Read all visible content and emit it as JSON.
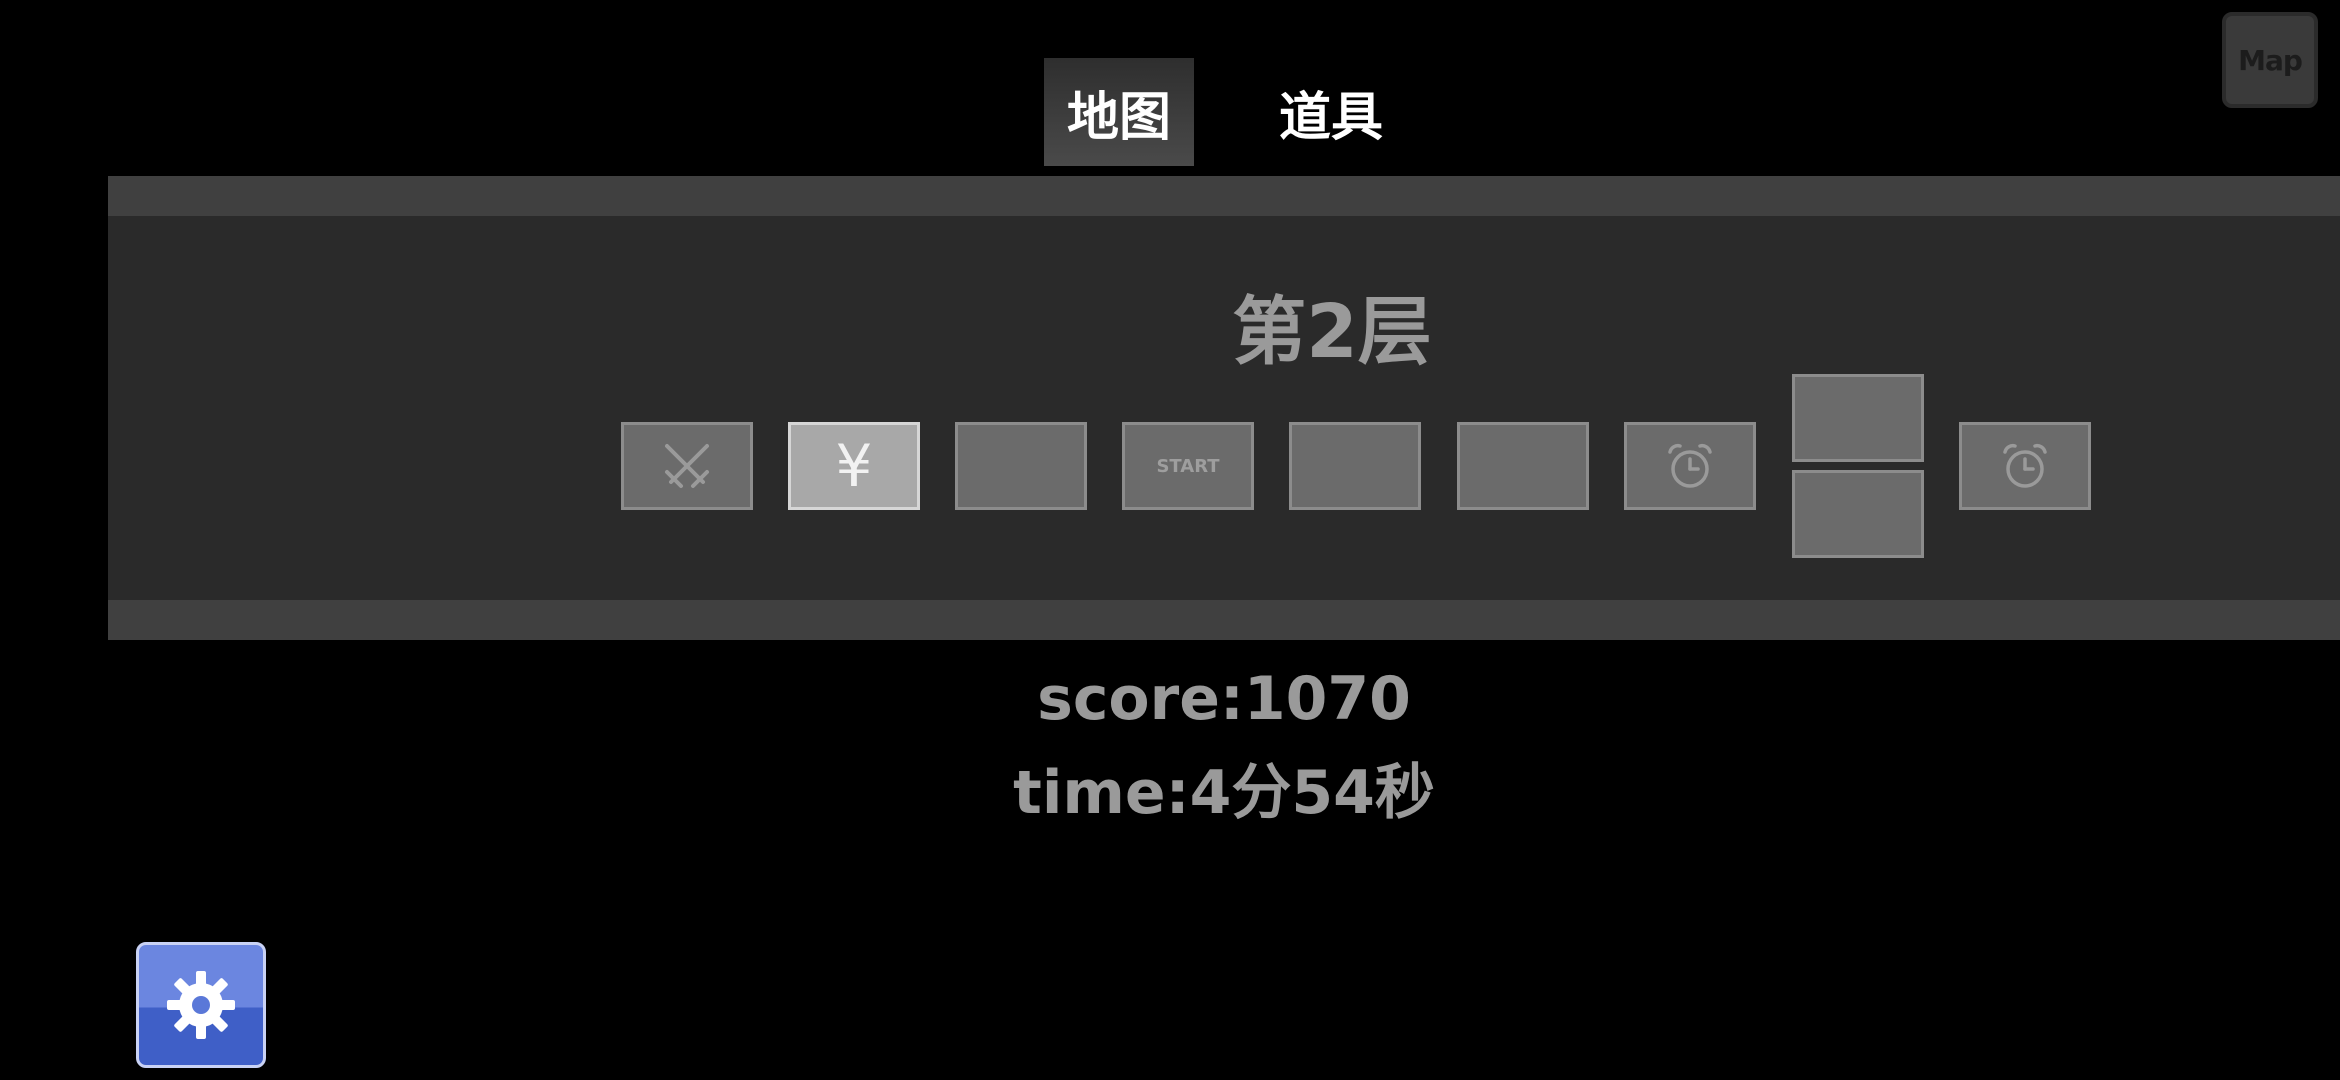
{
  "tabs": {
    "map_label": "地图",
    "items_label": "道具"
  },
  "map_button": {
    "label": "Map",
    "icon": "map-icon"
  },
  "floor": {
    "title": "第2层"
  },
  "rooms": [
    {
      "type": "battle",
      "icon": "crossed-swords-icon"
    },
    {
      "type": "shop",
      "label": "¥",
      "current": true
    },
    {
      "type": "empty"
    },
    {
      "type": "start",
      "label": "START"
    },
    {
      "type": "empty"
    },
    {
      "type": "empty"
    },
    {
      "type": "timed",
      "icon": "alarm-clock-icon"
    },
    {
      "type": "empty"
    },
    {
      "type": "empty"
    },
    {
      "type": "timed",
      "icon": "alarm-clock-icon"
    }
  ],
  "stats": {
    "score": "score:1070",
    "time": "time:4分54秒"
  },
  "settings_button": {
    "icon": "gear-icon"
  },
  "colors": {
    "background": "#000000",
    "panel": "#2a2a2a",
    "panel_band": "#404040",
    "room": "#6b6b6b",
    "room_current": "#a8a8a8",
    "text_gray": "#9a9a9a",
    "settings_blue": "#5a78d8"
  }
}
